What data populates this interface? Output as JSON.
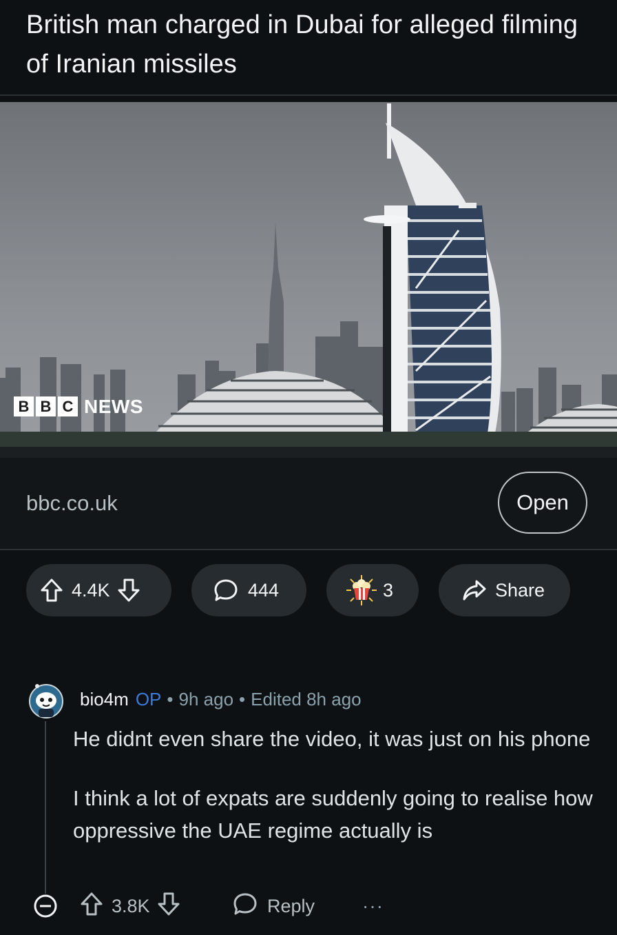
{
  "post": {
    "title": "British man charged in Dubai for alleged filming of Iranian missiles",
    "thumbnail": {
      "logo_text": [
        "B",
        "B",
        "C",
        "NEWS"
      ]
    },
    "link": {
      "domain": "bbc.co.uk",
      "open_label": "Open"
    },
    "actions": {
      "votes": "4.4K",
      "comments": "444",
      "awards": "3",
      "share_label": "Share"
    }
  },
  "comment": {
    "username": "bio4m",
    "op_badge": "OP",
    "separator": "•",
    "posted": "9h ago",
    "edited": "Edited 8h ago",
    "paragraphs": [
      "He didnt even share the video, it was just on his phone",
      "I think a lot of expats are suddenly going to realise how oppressive the UAE regime actually is"
    ],
    "votes": "3.8K",
    "reply_label": "Reply",
    "more_label": "···"
  },
  "colors": {
    "background": "#0e1113",
    "pill": "#262c30",
    "op_blue": "#3d7bd9",
    "muted_text": "#8ba2ad"
  },
  "icons": {
    "upvote": "arrow-up-outline-icon",
    "downvote": "arrow-down-outline-icon",
    "comment": "speech-bubble-icon",
    "award": "popcorn-award-icon",
    "share": "share-arrow-icon",
    "collapse": "minus-circle-icon",
    "avatar": "snoo-avatar-icon"
  }
}
